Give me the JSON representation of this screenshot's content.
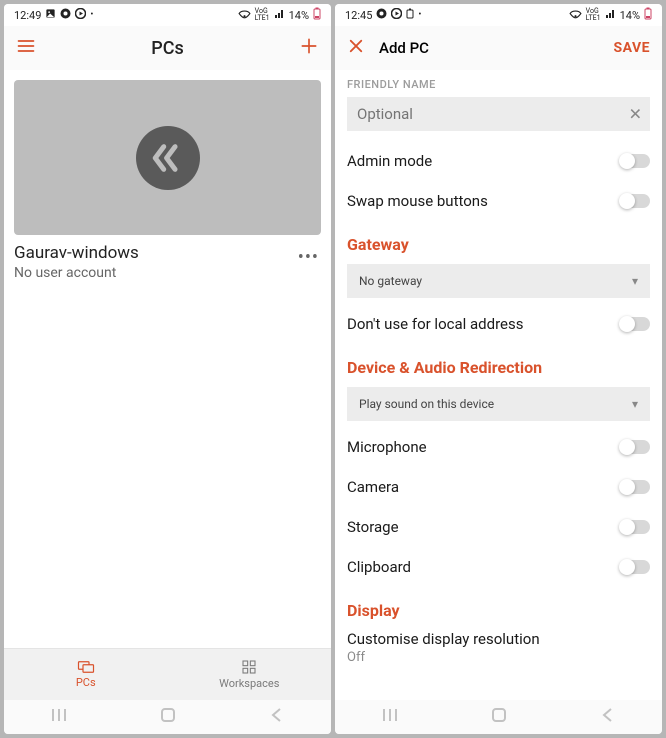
{
  "left": {
    "status": {
      "time": "12:49",
      "battery": "14%"
    },
    "appbar": {
      "title": "PCs"
    },
    "pc": {
      "name": "Gaurav-windows",
      "sub": "No user account"
    },
    "tabs": {
      "pcs": "PCs",
      "workspaces": "Workspaces"
    }
  },
  "right": {
    "status": {
      "time": "12:45",
      "battery": "14%"
    },
    "appbar": {
      "title": "Add PC",
      "save": "SAVE"
    },
    "friendly": {
      "label": "FRIENDLY NAME",
      "placeholder": "Optional"
    },
    "rows": {
      "admin": "Admin mode",
      "swap": "Swap mouse buttons",
      "dontLocal": "Don't use for local address",
      "mic": "Microphone",
      "cam": "Camera",
      "storage": "Storage",
      "clip": "Clipboard",
      "customise": "Customise display resolution",
      "off": "Off"
    },
    "sections": {
      "gateway": "Gateway",
      "device": "Device & Audio Redirection",
      "display": "Display"
    },
    "dropdowns": {
      "gateway": "No gateway",
      "sound": "Play sound on this device"
    }
  }
}
